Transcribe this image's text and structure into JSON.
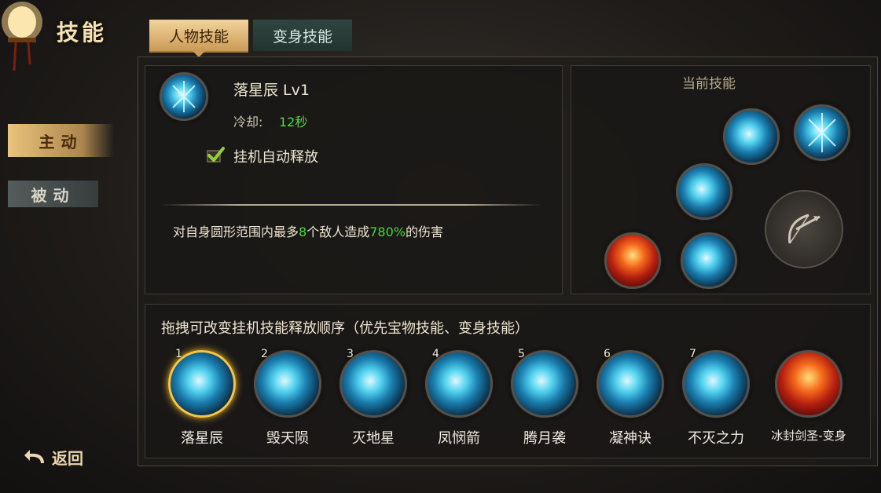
{
  "header": {
    "title": "技能"
  },
  "tabs": [
    {
      "label": "人物技能",
      "active": true
    },
    {
      "label": "变身技能",
      "active": false
    }
  ],
  "sidebar": {
    "items": [
      {
        "label": "主动",
        "active": true
      },
      {
        "label": "被动",
        "active": false
      }
    ],
    "back_label": "返回"
  },
  "skill_detail": {
    "name": "落星辰 Lv1",
    "cooldown_label": "冷却:",
    "cooldown_value": "12秒",
    "auto_release_label": "挂机自动释放",
    "auto_release_checked": true,
    "description_prefix": "对自身圆形范围内最多",
    "description_count": "8",
    "description_mid": "个敌人造成",
    "description_percent": "780%",
    "description_suffix": "的伤害"
  },
  "current_skills": {
    "title": "当前技能"
  },
  "order_section": {
    "hint": "拖拽可改变挂机技能释放顺序（优先宝物技能、变身技能）",
    "skills": [
      {
        "num": "1",
        "name": "落星辰",
        "style": "ice",
        "selected": true
      },
      {
        "num": "2",
        "name": "毁天陨",
        "style": "ice",
        "selected": false
      },
      {
        "num": "3",
        "name": "灭地星",
        "style": "ice",
        "selected": false
      },
      {
        "num": "4",
        "name": "凤悯箭",
        "style": "ice",
        "selected": false
      },
      {
        "num": "5",
        "name": "腾月袭",
        "style": "ice",
        "selected": false
      },
      {
        "num": "6",
        "name": "凝神诀",
        "style": "ice",
        "selected": false
      },
      {
        "num": "7",
        "name": "不灭之力",
        "style": "ice",
        "selected": false
      },
      {
        "num": "",
        "name": "冰封剑圣-变身",
        "style": "fire",
        "selected": false
      }
    ]
  },
  "colors": {
    "accent_gold": "#f2d49c",
    "highlight_green": "#45d93a",
    "selected_ring": "#f3c64a"
  }
}
